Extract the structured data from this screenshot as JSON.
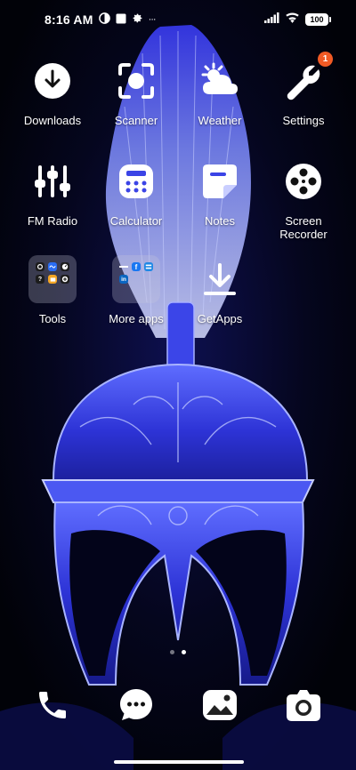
{
  "status_bar": {
    "time": "8:16 AM",
    "more_indicator": "···",
    "battery_level": "100"
  },
  "apps": [
    {
      "id": "downloads",
      "label": "Downloads",
      "icon": "download-icon"
    },
    {
      "id": "scanner",
      "label": "Scanner",
      "icon": "scanner-icon"
    },
    {
      "id": "weather",
      "label": "Weather",
      "icon": "weather-icon"
    },
    {
      "id": "settings",
      "label": "Settings",
      "icon": "wrench-icon",
      "badge": "1"
    },
    {
      "id": "fm-radio",
      "label": "FM Radio",
      "icon": "sliders-icon"
    },
    {
      "id": "calculator",
      "label": "Calculator",
      "icon": "calculator-icon"
    },
    {
      "id": "notes",
      "label": "Notes",
      "icon": "notes-icon"
    },
    {
      "id": "screen-recorder",
      "label": "Screen\nRecorder",
      "icon": "film-reel-icon"
    },
    {
      "id": "tools",
      "label": "Tools",
      "icon": "folder-icon"
    },
    {
      "id": "more-apps",
      "label": "More apps",
      "icon": "folder-icon"
    },
    {
      "id": "getapps",
      "label": "GetApps",
      "icon": "getapps-download-icon"
    }
  ],
  "dock": [
    {
      "id": "phone",
      "icon": "phone-icon"
    },
    {
      "id": "messages",
      "icon": "chat-bubble-icon"
    },
    {
      "id": "gallery",
      "icon": "gallery-icon"
    },
    {
      "id": "camera",
      "icon": "camera-icon"
    }
  ],
  "pages": {
    "count": 2,
    "active": 2
  },
  "colors": {
    "badge": "#f15a24",
    "wallpaper_primary": "#2a2fe6",
    "wallpaper_glow": "#8ea0ff"
  }
}
